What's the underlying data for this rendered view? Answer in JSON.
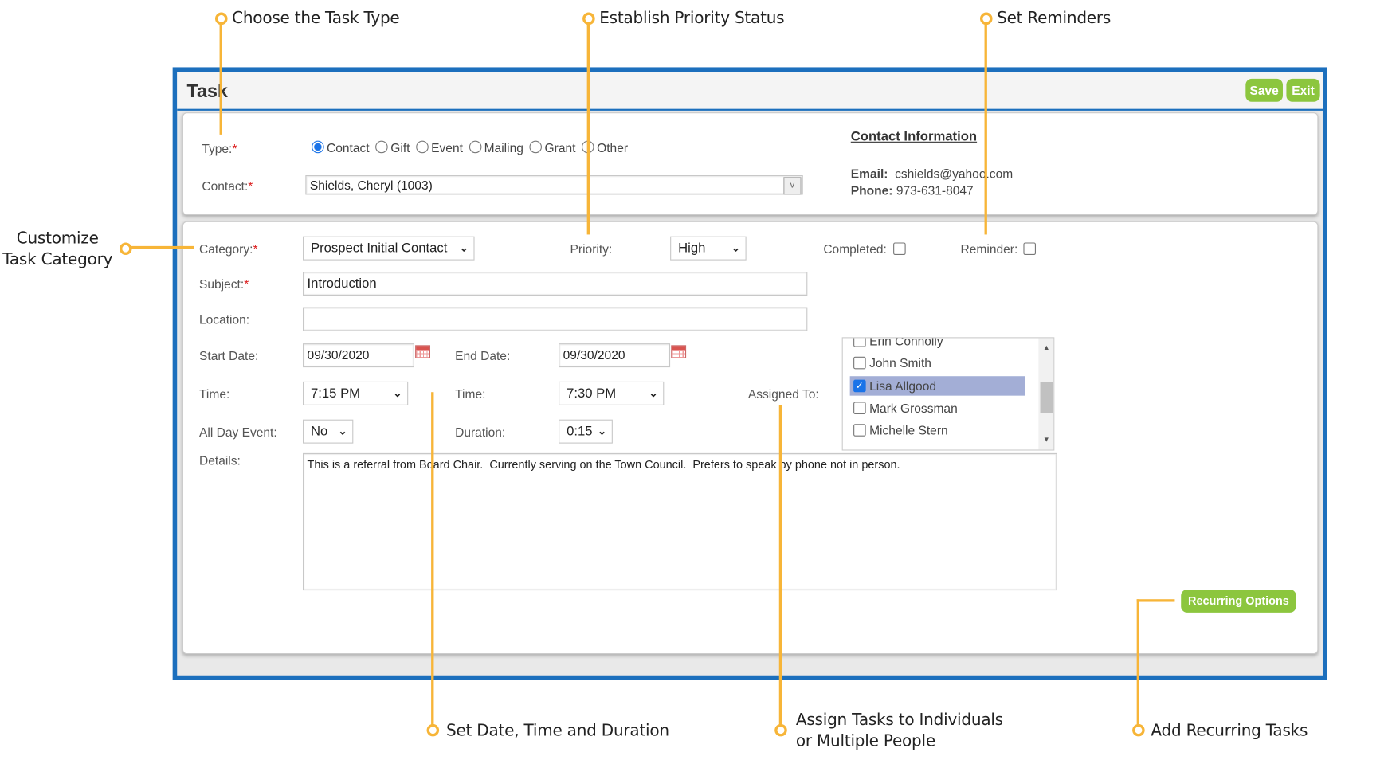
{
  "annotations": {
    "task_type": "Choose the Task Type",
    "priority": "Establish Priority Status",
    "reminders": "Set Reminders",
    "category_line1": "Customize",
    "category_line2": "Task Category",
    "date_time": "Set Date, Time and Duration",
    "assign_line1": "Assign Tasks to Individuals",
    "assign_line2": "or Multiple People",
    "recurring": "Add Recurring Tasks",
    "accent_color": "#f7b538"
  },
  "window": {
    "title": "Task",
    "save_label": "Save",
    "exit_label": "Exit",
    "frame_color": "#1c6fbd",
    "button_color": "#8cc63e"
  },
  "contact_panel": {
    "type_label": "Type:",
    "types": [
      "Contact",
      "Gift",
      "Event",
      "Mailing",
      "Grant",
      "Other"
    ],
    "selected_type": "Contact",
    "contact_label": "Contact:",
    "contact_value": "Shields, Cheryl (1003)",
    "info_title": "Contact Information",
    "email_label": "Email:",
    "email": "cshields@yahoo.com",
    "phone_label": "Phone:",
    "phone": "973-631-8047"
  },
  "task_form": {
    "category_label": "Category:",
    "category_value": "Prospect Initial Contact",
    "priority_label": "Priority:",
    "priority_value": "High",
    "completed_label": "Completed:",
    "completed": false,
    "reminder_label": "Reminder:",
    "reminder": false,
    "subject_label": "Subject:",
    "subject_value": "Introduction",
    "location_label": "Location:",
    "location_value": "",
    "start_date_label": "Start Date:",
    "start_date": "09/30/2020",
    "end_date_label": "End Date:",
    "end_date": "09/30/2020",
    "start_time_label": "Time:",
    "start_time": "7:15 PM",
    "end_time_label": "Time:",
    "end_time": "7:30 PM",
    "all_day_label": "All Day Event:",
    "all_day_value": "No",
    "duration_label": "Duration:",
    "duration_value": "0:15",
    "assigned_label": "Assigned To:",
    "assignees": [
      {
        "name": "Erin Connolly",
        "checked": false
      },
      {
        "name": "John Smith",
        "checked": false
      },
      {
        "name": "Lisa Allgood",
        "checked": true
      },
      {
        "name": "Mark Grossman",
        "checked": false
      },
      {
        "name": "Michelle Stern",
        "checked": false
      }
    ],
    "details_label": "Details:",
    "details_value": "This is a referral from Board Chair.  Currently serving on the Town Council.  Prefers to speak by phone not in person.",
    "recurring_label": "Recurring Options"
  }
}
